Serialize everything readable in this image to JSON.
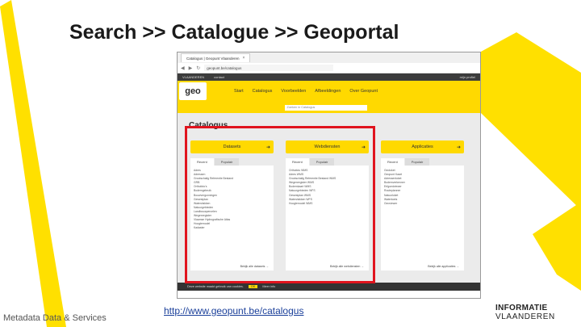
{
  "slide": {
    "title": "Search >> Catalogue >> Geoportal",
    "footer_left": "Metadata Data & Services",
    "footer_link": "http://www.geopunt.be/catalogus",
    "logo_line1": "INFORMATIE",
    "logo_line2": "VLAANDEREN",
    "accent_color": "#ffe000"
  },
  "browser": {
    "tab_title": "Catalogus | Geopunt Vlaanderen",
    "tab_close": "×",
    "url": "geopunt.be/catalogus",
    "back_icon": "◀",
    "forward_icon": "▶",
    "refresh_icon": "↻",
    "topstrip_left": "VLAANDEREN",
    "topstrip_mid": "contact",
    "topstrip_right": "mijn profiel",
    "logo_text": "geo",
    "nav": [
      "Start",
      "Catalogus",
      "Voorbeelden",
      "Afbeeldingen",
      "Over Geopunt"
    ],
    "search_placeholder": "Zoeken in Catalogus",
    "catalogus_title": "Catalogus",
    "columns": [
      {
        "header": "Datasets",
        "tabs": [
          "Recent",
          "Populair"
        ],
        "items": [
          "Adres",
          "Adressen",
          "Grootschalig Referentie Bestand",
          "GRB",
          "Orthofoto's",
          "Bodemgebruik",
          "Bouwvergunningen",
          "Gewestplan",
          "Watervlakken",
          "Natuurgebieden",
          "Landbouwpercelen",
          "Wegenregister",
          "Vlaamse Hydrografische Atlas",
          "Hoogtemodel",
          "Kadaster"
        ],
        "footer": "Bekijk alle datasets →"
      },
      {
        "header": "Webdiensten",
        "tabs": [
          "Recent",
          "Populair"
        ],
        "items": [
          "Orthofoto WMS",
          "Adres WMS",
          "Grootschalig Referentie Bestand WMS",
          "Wegenregister WMS",
          "Bodemkaart WMS",
          "Natuurgebieden WFS",
          "Gewestplan WMS",
          "Watervlakken WFS",
          "Hoogtemodel WMS"
        ],
        "footer": "Bekijk alle webdiensten →"
      },
      {
        "header": "Applicaties",
        "tabs": [
          "Recent",
          "Populair"
        ],
        "items": [
          "Geoloket",
          "Geopunt Kaart",
          "Adressenloket",
          "Bodemverkenner",
          "Erfgoedviewer",
          "Routeplanner",
          "Natuurloket",
          "Watertoets",
          "Geoviewer"
        ],
        "footer": "Bekijk alle applicaties →"
      }
    ],
    "cookie_text": "Deze website maakt gebruik van cookies.",
    "cookie_ok": "OK",
    "cookie_more": "Meer info"
  }
}
